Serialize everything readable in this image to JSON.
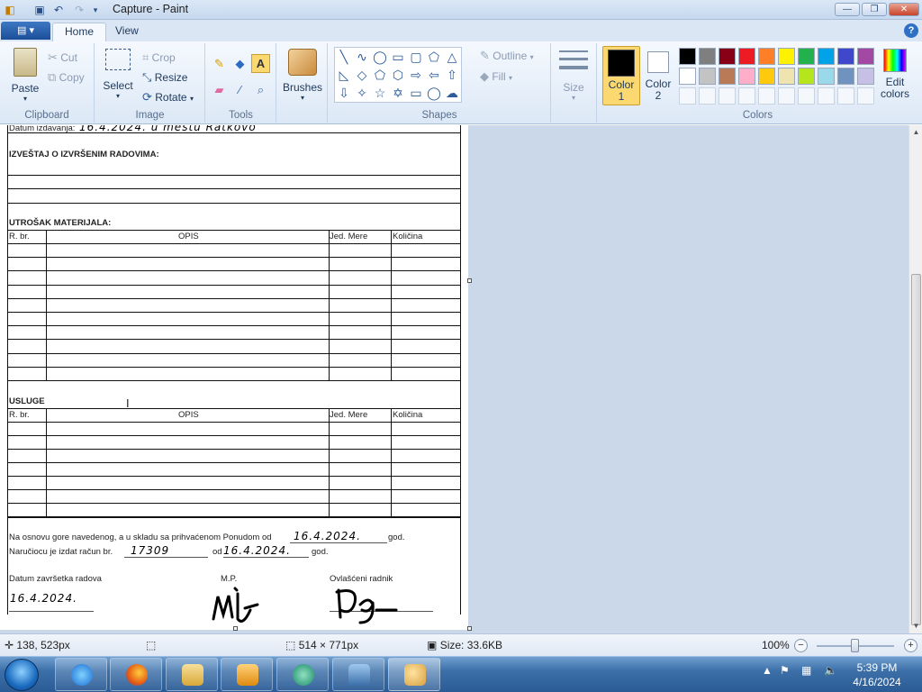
{
  "window": {
    "title": "Capture - Paint",
    "minimize": "—",
    "maximize": "❐",
    "close": "✕"
  },
  "quick_access": [
    "save-icon",
    "undo-icon",
    "redo-icon",
    "customize-icon"
  ],
  "tabs": {
    "app_menu": "▤ ▾",
    "home": "Home",
    "view": "View",
    "help": "?"
  },
  "ribbon": {
    "clipboard": {
      "label": "Clipboard",
      "paste": "Paste",
      "cut": "Cut",
      "copy": "Copy"
    },
    "image": {
      "label": "Image",
      "select": "Select",
      "crop": "Crop",
      "resize": "Resize",
      "rotate": "Rotate"
    },
    "tools": {
      "label": "Tools"
    },
    "brushes": {
      "label": "Brushes"
    },
    "shapes": {
      "label": "Shapes",
      "outline": "Outline",
      "fill": "Fill"
    },
    "size": {
      "label": "Size"
    },
    "colors": {
      "label": "Colors",
      "color1": "Color 1",
      "color1_a": "Color",
      "color1_b": "1",
      "color2_a": "Color",
      "color2_b": "2",
      "edit_a": "Edit",
      "edit_b": "colors",
      "color1_value": "#000000",
      "color2_value": "#ffffff",
      "palette_row1": [
        "#000000",
        "#7f7f7f",
        "#880015",
        "#ed1c24",
        "#ff7f27",
        "#fff200",
        "#22b14c",
        "#00a2e8",
        "#3f48cc",
        "#a349a4"
      ],
      "palette_row2": [
        "#ffffff",
        "#c3c3c3",
        "#b97a57",
        "#ffaec9",
        "#ffc90e",
        "#efe4b0",
        "#b5e61d",
        "#99d9ea",
        "#7092be",
        "#c8bfe7"
      ]
    }
  },
  "document": {
    "datum_label": "Datum izdavanja:",
    "datum_hand": "16.4.2024. u mestu Ratkovo",
    "izvestaj": "IZVEŠTAJ O IZVRŠENIM RADOVIMA:",
    "utrosak": "UTROŠAK MATERIJALA:",
    "usluge": "USLUGE",
    "col_rbr": "R. br.",
    "col_opis": "OPIS",
    "col_jed": "Jed. Mere",
    "col_kol": "Količina",
    "osnov_text": "Na osnovu gore navedenog, a u skladu sa prihvaćenom Ponudom  od",
    "osnov_date": "16.4.2024.",
    "god1": "god.",
    "racun_text": "Naručiocu je izdat račun br.",
    "racun_br": "17309",
    "od": "od",
    "racun_date": "16.4.2024.",
    "god2": "god.",
    "zavrsetak_label": "Datum završetka radova",
    "zavrsetak_date": "16.4.2024.",
    "mp": "M.P.",
    "ovlasceni": "Ovlašćeni radnik"
  },
  "status": {
    "cursor_pos": "138, 523px",
    "selection": "",
    "image_size": "514 × 771px",
    "file_size": "Size: 33.6KB",
    "zoom": "100%",
    "zoom_fraction": 0.5
  },
  "taskbar": {
    "apps": [
      "internet-explorer",
      "firefox",
      "file-explorer",
      "media-player",
      "app-5",
      "photo-viewer",
      "paint"
    ],
    "time": "5:39 PM",
    "date": "4/16/2024"
  }
}
